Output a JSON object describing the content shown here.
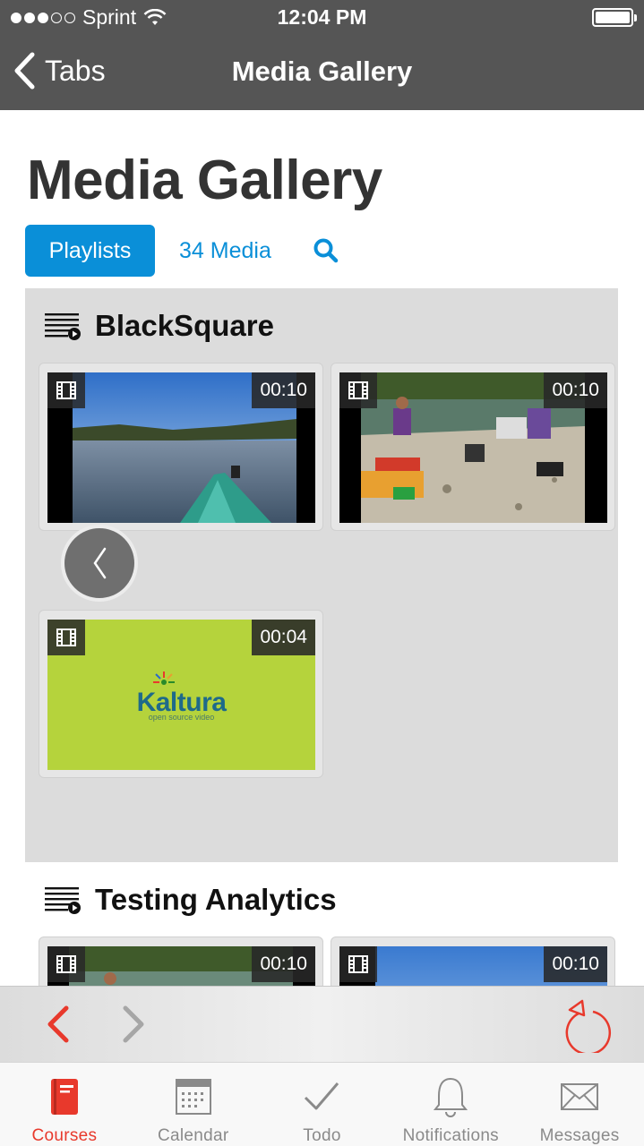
{
  "status_bar": {
    "carrier": "Sprint",
    "time": "12:04 PM"
  },
  "nav": {
    "back_label": "Tabs",
    "title": "Media Gallery"
  },
  "page": {
    "title": "Media Gallery",
    "tabs": {
      "playlists": "Playlists",
      "media": "34 Media"
    }
  },
  "playlists": [
    {
      "name": "BlackSquare",
      "items": [
        {
          "duration": "00:10",
          "thumbnail": "river-kayak-bow"
        },
        {
          "duration": "00:10",
          "thumbnail": "riverbank-campers"
        },
        {
          "duration": "00:04",
          "thumbnail": "kaltura-logo"
        }
      ]
    },
    {
      "name": "Testing Analytics",
      "items": [
        {
          "duration": "00:10",
          "thumbnail": "riverbank-campers"
        },
        {
          "duration": "00:10",
          "thumbnail": "sky-river"
        }
      ]
    }
  ],
  "kaltura": {
    "logo_text": "Kaltura",
    "tagline": "open source video"
  },
  "tab_bar": {
    "items": [
      {
        "label": "Courses",
        "icon": "courses-icon",
        "active": true
      },
      {
        "label": "Calendar",
        "icon": "calendar-icon",
        "active": false
      },
      {
        "label": "Todo",
        "icon": "todo-icon",
        "active": false
      },
      {
        "label": "Notifications",
        "icon": "notifications-icon",
        "active": false
      },
      {
        "label": "Messages",
        "icon": "messages-icon",
        "active": false
      }
    ]
  },
  "colors": {
    "accent": "#0a8fd8",
    "active_tab": "#e8392c",
    "nav_bg": "#555555",
    "panel_bg": "#dcdcdc"
  }
}
